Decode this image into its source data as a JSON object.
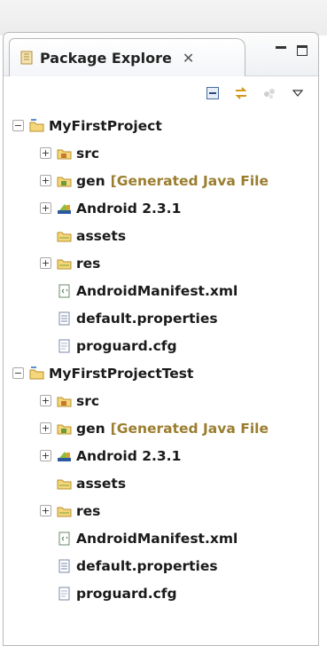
{
  "view": {
    "title": "Package Explore",
    "close_glyph": "✕"
  },
  "toolbar": {
    "icons": [
      "collapse-all-icon",
      "link-with-editor-icon",
      "focus-icon",
      "view-menu-icon"
    ]
  },
  "projects": [
    {
      "name": "MyFirstProject",
      "children": [
        {
          "label": "src",
          "decoration": "",
          "icon": "source-folder-icon",
          "expandable": true
        },
        {
          "label": "gen",
          "decoration": "[Generated Java File",
          "icon": "gen-folder-icon",
          "expandable": true
        },
        {
          "label": "Android 2.3.1",
          "decoration": "",
          "icon": "android-library-icon",
          "expandable": true
        },
        {
          "label": "assets",
          "decoration": "",
          "icon": "folder-icon",
          "expandable": false
        },
        {
          "label": "res",
          "decoration": "",
          "icon": "folder-icon",
          "expandable": true
        },
        {
          "label": "AndroidManifest.xml",
          "decoration": "",
          "icon": "xml-file-icon",
          "expandable": false
        },
        {
          "label": "default.properties",
          "decoration": "",
          "icon": "text-file-icon",
          "expandable": false
        },
        {
          "label": "proguard.cfg",
          "decoration": "",
          "icon": "file-icon",
          "expandable": false
        }
      ]
    },
    {
      "name": "MyFirstProjectTest",
      "children": [
        {
          "label": "src",
          "decoration": "",
          "icon": "source-folder-icon",
          "expandable": true
        },
        {
          "label": "gen",
          "decoration": "[Generated Java File",
          "icon": "gen-folder-icon",
          "expandable": true
        },
        {
          "label": "Android 2.3.1",
          "decoration": "",
          "icon": "android-library-icon",
          "expandable": true
        },
        {
          "label": "assets",
          "decoration": "",
          "icon": "folder-icon",
          "expandable": false
        },
        {
          "label": "res",
          "decoration": "",
          "icon": "folder-icon",
          "expandable": true
        },
        {
          "label": "AndroidManifest.xml",
          "decoration": "",
          "icon": "xml-file-icon",
          "expandable": false
        },
        {
          "label": "default.properties",
          "decoration": "",
          "icon": "text-file-icon",
          "expandable": false
        },
        {
          "label": "proguard.cfg",
          "decoration": "",
          "icon": "file-icon",
          "expandable": false
        }
      ]
    }
  ],
  "colors": {
    "decoration": "#9a7d2e",
    "border": "#b8b8b8"
  }
}
